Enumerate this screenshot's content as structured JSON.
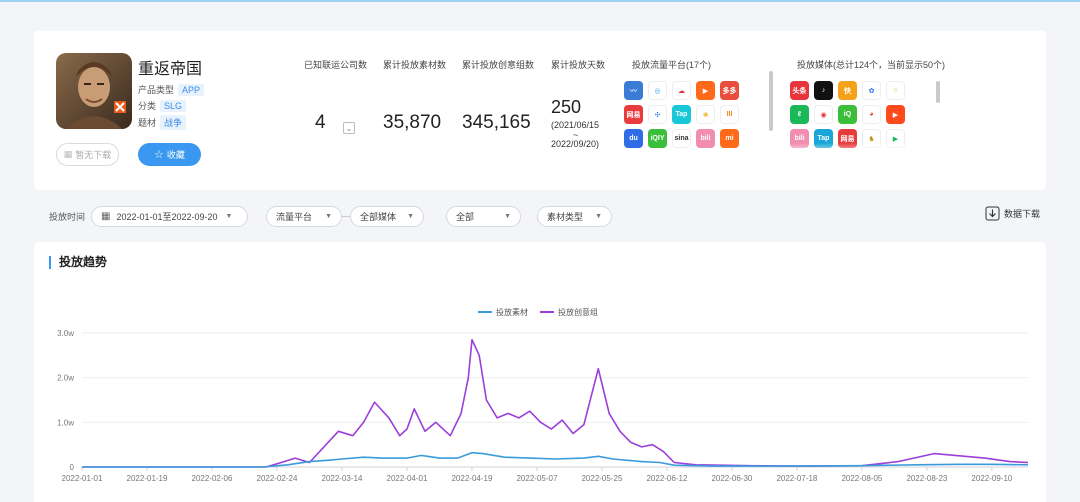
{
  "app": {
    "name": "重返帝国",
    "type_label": "产品类型",
    "type_value": "APP",
    "category_label": "分类",
    "category_value": "SLG",
    "theme_label": "题材",
    "theme_value": "战争",
    "no_download_label": "暂无下载",
    "favorite_label": "收藏"
  },
  "stats": {
    "companies_label": "已知联运公司数",
    "companies_value": "4",
    "materials_label": "累计投放素材数",
    "materials_value": "35,870",
    "creatives_label": "累计投放创意组数",
    "creatives_value": "345,165",
    "days_label": "累计投放天数",
    "days_value": "250",
    "days_start": "(2021/06/15",
    "days_sep": "~",
    "days_end": "2022/09/20)"
  },
  "platforms": {
    "label": "投放流量平台(17个)",
    "icons": [
      {
        "name": "bird-icon",
        "color": "#3a7bd5",
        "text": "〰"
      },
      {
        "name": "swirl-icon",
        "color": "#ffffff",
        "text": "◎",
        "fg": "#2fa3e6"
      },
      {
        "name": "cloud-icon",
        "color": "#ffffff",
        "text": "☁",
        "fg": "#e5333b"
      },
      {
        "name": "play-icon",
        "color": "#ff6a1a",
        "text": "▶"
      },
      {
        "name": "duoduo-icon",
        "color": "#e84e3b",
        "text": "多多"
      },
      {
        "name": "netease-icon",
        "color": "#e83b3b",
        "text": "网易"
      },
      {
        "name": "pinwheel-icon",
        "color": "#ffffff",
        "text": "✣",
        "fg": "#2f8fe6"
      },
      {
        "name": "tap-icon",
        "color": "#18c7d8",
        "text": "Tap"
      },
      {
        "name": "flower-icon",
        "color": "#ffffff",
        "text": "❀",
        "fg": "#f0b01b"
      },
      {
        "name": "stripes-icon",
        "color": "#ffffff",
        "text": "III",
        "fg": "#f08a1b"
      },
      {
        "name": "baidu-icon",
        "color": "#2f6de6",
        "text": "du"
      },
      {
        "name": "iqiyi-icon",
        "color": "#3bbf3b",
        "text": "iQIY"
      },
      {
        "name": "sina-icon",
        "color": "#ffffff",
        "text": "sina",
        "fg": "#333333"
      },
      {
        "name": "bilibili-icon",
        "color": "#f08db0",
        "text": "bili"
      },
      {
        "name": "xiaomi-icon",
        "color": "#ff6a1a",
        "text": "mi"
      }
    ]
  },
  "media": {
    "label": "投放媒体(总计124个，当前显示50个)",
    "icons": [
      {
        "name": "toutiao-icon",
        "color": "#e8353b",
        "text": "头条"
      },
      {
        "name": "douyin-icon",
        "color": "#111111",
        "text": "♪"
      },
      {
        "name": "ks-icon",
        "color": "#f5a21b",
        "text": "快"
      },
      {
        "name": "baidu-paw-icon",
        "color": "#ffffff",
        "text": "✿",
        "fg": "#2f6de6"
      },
      {
        "name": "ring-icon",
        "color": "#ffffff",
        "text": "○",
        "fg": "#f0a01b"
      },
      {
        "name": "leaf-icon",
        "color": "#1bb85a",
        "text": "ℓ"
      },
      {
        "name": "chrome-icon",
        "color": "#ffffff",
        "text": "◉",
        "fg": "#e8353b"
      },
      {
        "name": "iqiyi-media-icon",
        "color": "#3bbf3b",
        "text": "iQ"
      },
      {
        "name": "weibo-icon",
        "color": "#ffffff",
        "text": "◕",
        "fg": "#e8353b"
      },
      {
        "name": "kuaishou-icon",
        "color": "#ff4a1b",
        "text": "▶"
      },
      {
        "name": "bili-media-icon",
        "color": "#f08db0",
        "text": "bili"
      },
      {
        "name": "tap-media-icon",
        "color": "#18a7d8",
        "text": "Tap"
      },
      {
        "name": "netease-media-icon",
        "color": "#e83b3b",
        "text": "网易"
      },
      {
        "name": "deer-icon",
        "color": "#ffffff",
        "text": "♞",
        "fg": "#c8881b"
      },
      {
        "name": "playstore-icon",
        "color": "#ffffff",
        "text": "▶",
        "fg": "#1bb85a"
      }
    ]
  },
  "filters": {
    "time_label": "投放时间",
    "date_range": "2022-01-01至2022-09-20",
    "platform": "流量平台",
    "media": "全部媒体",
    "all": "全部",
    "material_type": "素材类型",
    "download_label": "数据下载"
  },
  "chart_section": {
    "title": "投放趋势"
  },
  "colors": {
    "series_material": "#3a9bdc",
    "series_creative": "#9b3fd9",
    "accent": "#3a98f0"
  },
  "chart_data": {
    "type": "line",
    "title": "",
    "xlabel": "",
    "ylabel": "",
    "ylim": [
      0,
      3.0
    ],
    "y_unit": "w",
    "yticks": [
      "0",
      "1.0w",
      "2.0w",
      "3.0w"
    ],
    "x_tick_labels": [
      "2022-01-01",
      "2022-01-19",
      "2022-02-06",
      "2022-02-24",
      "2022-03-14",
      "2022-04-01",
      "2022-04-19",
      "2022-05-07",
      "2022-05-25",
      "2022-06-12",
      "2022-06-30",
      "2022-07-18",
      "2022-08-05",
      "2022-08-23",
      "2022-09-10"
    ],
    "x_start": "2022-01-01",
    "x_end": "2022-09-20",
    "legend_position": "top-center",
    "grid": true,
    "series": [
      {
        "name": "投放素材",
        "points": [
          [
            "2022-01-01",
            0
          ],
          [
            "2022-02-20",
            0
          ],
          [
            "2022-02-27",
            0.05
          ],
          [
            "2022-03-05",
            0.12
          ],
          [
            "2022-03-10",
            0.15
          ],
          [
            "2022-03-14",
            0.18
          ],
          [
            "2022-03-20",
            0.22
          ],
          [
            "2022-03-25",
            0.2
          ],
          [
            "2022-04-01",
            0.2
          ],
          [
            "2022-04-05",
            0.26
          ],
          [
            "2022-04-10",
            0.2
          ],
          [
            "2022-04-15",
            0.2
          ],
          [
            "2022-04-19",
            0.32
          ],
          [
            "2022-04-22",
            0.3
          ],
          [
            "2022-04-28",
            0.22
          ],
          [
            "2022-05-05",
            0.2
          ],
          [
            "2022-05-12",
            0.18
          ],
          [
            "2022-05-20",
            0.2
          ],
          [
            "2022-05-24",
            0.24
          ],
          [
            "2022-05-28",
            0.18
          ],
          [
            "2022-06-05",
            0.12
          ],
          [
            "2022-06-10",
            0.1
          ],
          [
            "2022-06-14",
            0.04
          ],
          [
            "2022-06-25",
            0.02
          ],
          [
            "2022-07-15",
            0.02
          ],
          [
            "2022-08-05",
            0.03
          ],
          [
            "2022-08-20",
            0.05
          ],
          [
            "2022-09-01",
            0.06
          ],
          [
            "2022-09-10",
            0.06
          ],
          [
            "2022-09-20",
            0.05
          ]
        ]
      },
      {
        "name": "投放创意组",
        "points": [
          [
            "2022-01-01",
            0
          ],
          [
            "2022-02-21",
            0
          ],
          [
            "2022-02-26",
            0.12
          ],
          [
            "2022-03-01",
            0.2
          ],
          [
            "2022-03-05",
            0.1
          ],
          [
            "2022-03-09",
            0.45
          ],
          [
            "2022-03-13",
            0.8
          ],
          [
            "2022-03-17",
            0.7
          ],
          [
            "2022-03-20",
            1.0
          ],
          [
            "2022-03-23",
            1.45
          ],
          [
            "2022-03-27",
            1.1
          ],
          [
            "2022-03-30",
            0.7
          ],
          [
            "2022-04-01",
            0.85
          ],
          [
            "2022-04-03",
            1.3
          ],
          [
            "2022-04-06",
            0.8
          ],
          [
            "2022-04-09",
            1.0
          ],
          [
            "2022-04-13",
            0.7
          ],
          [
            "2022-04-16",
            1.2
          ],
          [
            "2022-04-18",
            2.0
          ],
          [
            "2022-04-19",
            2.85
          ],
          [
            "2022-04-21",
            2.5
          ],
          [
            "2022-04-23",
            1.5
          ],
          [
            "2022-04-26",
            1.1
          ],
          [
            "2022-04-29",
            1.2
          ],
          [
            "2022-05-02",
            1.1
          ],
          [
            "2022-05-05",
            1.25
          ],
          [
            "2022-05-08",
            1.0
          ],
          [
            "2022-05-11",
            0.85
          ],
          [
            "2022-05-14",
            1.05
          ],
          [
            "2022-05-17",
            0.75
          ],
          [
            "2022-05-20",
            0.95
          ],
          [
            "2022-05-24",
            2.2
          ],
          [
            "2022-05-27",
            1.2
          ],
          [
            "2022-05-30",
            0.8
          ],
          [
            "2022-06-02",
            0.55
          ],
          [
            "2022-06-05",
            0.45
          ],
          [
            "2022-06-08",
            0.5
          ],
          [
            "2022-06-11",
            0.35
          ],
          [
            "2022-06-14",
            0.1
          ],
          [
            "2022-06-20",
            0.05
          ],
          [
            "2022-07-05",
            0.03
          ],
          [
            "2022-07-20",
            0.02
          ],
          [
            "2022-08-05",
            0.03
          ],
          [
            "2022-08-15",
            0.12
          ],
          [
            "2022-08-25",
            0.3
          ],
          [
            "2022-09-01",
            0.25
          ],
          [
            "2022-09-08",
            0.2
          ],
          [
            "2022-09-15",
            0.12
          ],
          [
            "2022-09-20",
            0.1
          ]
        ]
      }
    ]
  }
}
